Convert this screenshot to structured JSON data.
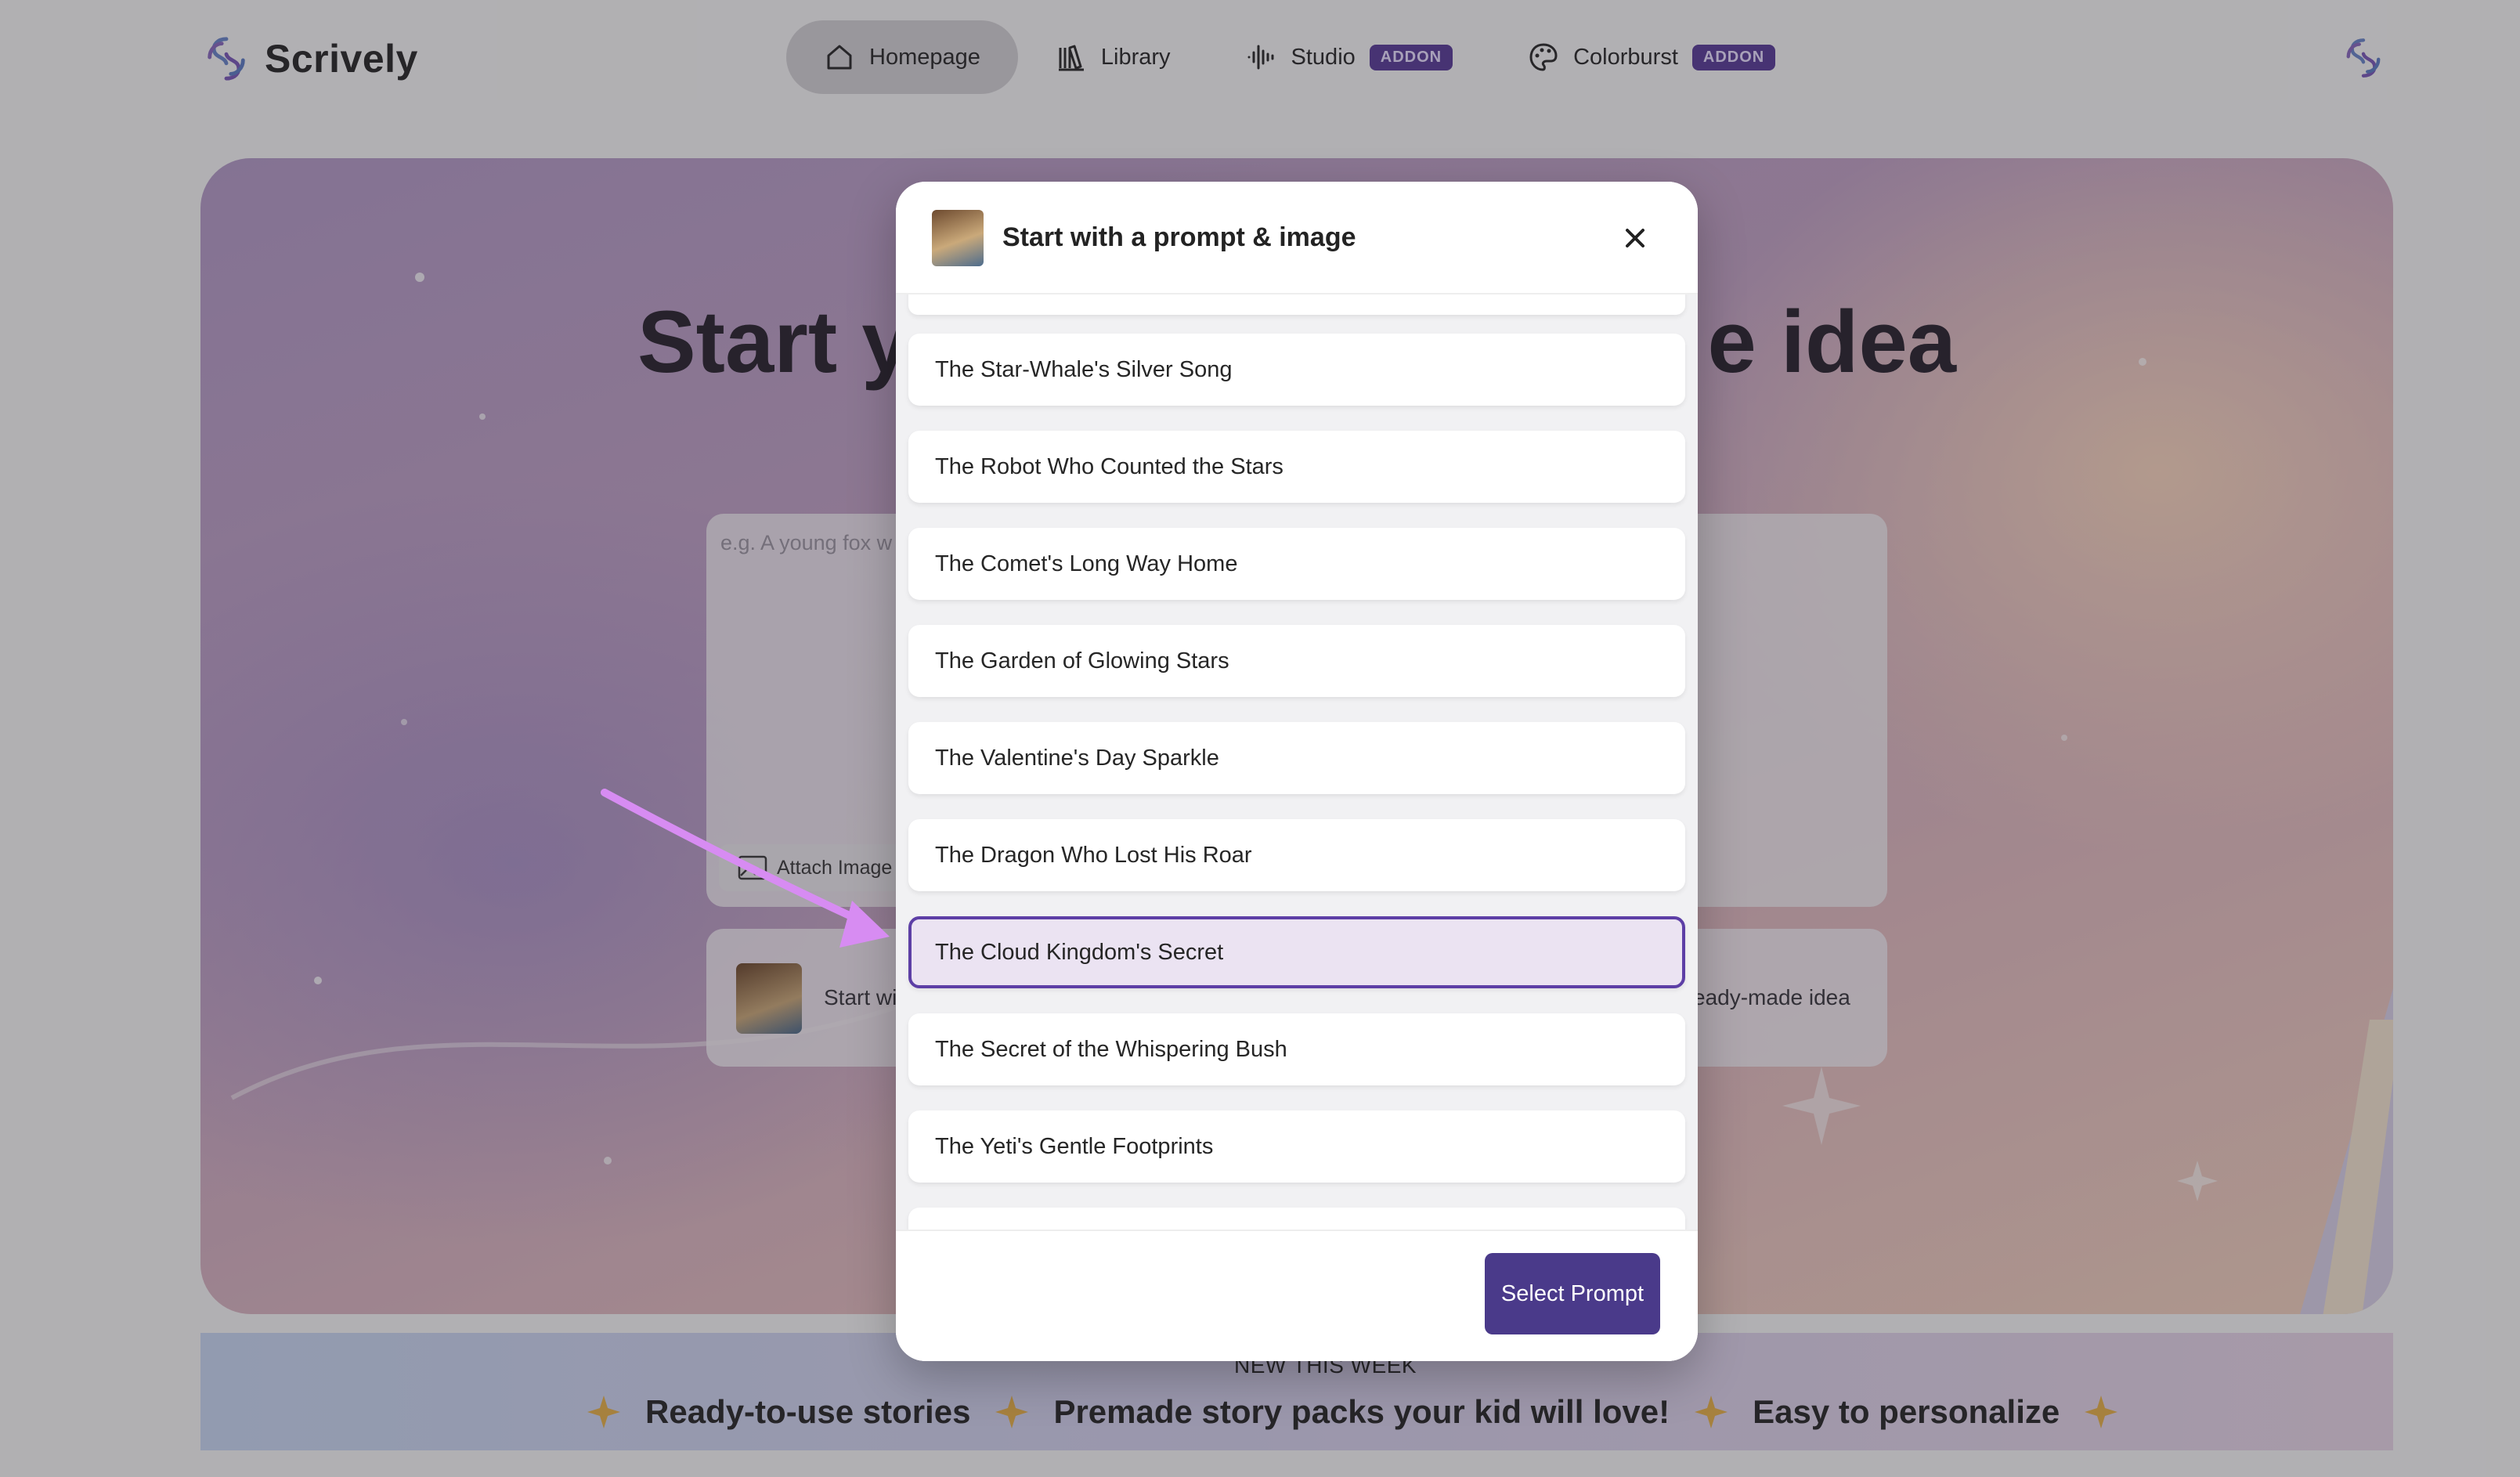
{
  "app": {
    "name": "Scrively"
  },
  "nav": {
    "tabs": [
      {
        "label": "Homepage",
        "icon": "home-icon",
        "active": true
      },
      {
        "label": "Library",
        "icon": "library-icon"
      },
      {
        "label": "Studio",
        "icon": "audio-waveform-icon",
        "badge": "ADDON"
      },
      {
        "label": "Colorburst",
        "icon": "palette-icon",
        "badge": "ADDON"
      }
    ]
  },
  "hero": {
    "title_left": "Start y",
    "title_right": "e idea",
    "prompt_placeholder": "e.g. A young fox w",
    "attach_label": "Attach Image",
    "start_card_text": "Start wi",
    "readymade_text": "eady-made idea"
  },
  "modal": {
    "title": "Start with a prompt & image",
    "prompts": [
      "The Star-Whale's Silver Song",
      "The Robot Who Counted the Stars",
      "The Comet's Long Way Home",
      "The Garden of Glowing Stars",
      "The Valentine's Day Sparkle",
      "The Dragon Who Lost His Roar",
      "The Cloud Kingdom's Secret",
      "The Secret of the Whispering Bush",
      "The Yeti's Gentle Footprints"
    ],
    "selected_index": 6,
    "select_button_label": "Select Prompt"
  },
  "banner": {
    "kicker": "NEW THIS WEEK",
    "items": [
      "Ready-to-use stories",
      "Premade story packs your kid will love!",
      "Easy to personalize"
    ]
  },
  "colors": {
    "accent": "#4a3a8a",
    "selected_border": "#5d3fa6",
    "selected_bg": "#ebe3f2",
    "badge": "#5a3f98",
    "annotation_arrow": "#d78cf2"
  }
}
